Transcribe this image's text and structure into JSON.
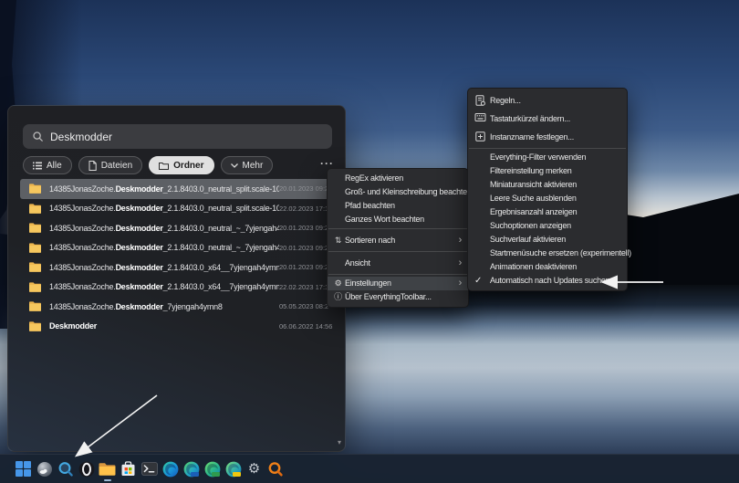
{
  "desktop": {
    "wallpaper_colors": {
      "sky_top": "#1c3258",
      "sky_mid": "#3f5d8a",
      "horizon": "#e6e3dc",
      "mountain": "#06090e",
      "water_light": "#b3c0cc",
      "water_dark": "#16202e",
      "taskbar": "#192332"
    }
  },
  "search_window": {
    "search": {
      "value": "Deskmodder",
      "icon": "search-icon"
    },
    "filters": [
      {
        "label": "Alle",
        "icon": "list-icon",
        "selected": false
      },
      {
        "label": "Dateien",
        "icon": "file-icon",
        "selected": false
      },
      {
        "label": "Ordner",
        "icon": "folder-icon",
        "selected": true
      },
      {
        "label": "Mehr",
        "icon": "chevron-down-icon",
        "selected": false
      }
    ],
    "more_label": "···",
    "results": [
      {
        "prefix": "14385JonasZoche.",
        "bold": "Deskmodder",
        "suffix": "_2.1.8403.0_neutral_split.scale-10...",
        "date": "20.01.2023 09:2",
        "selected": true
      },
      {
        "prefix": "14385JonasZoche.",
        "bold": "Deskmodder",
        "suffix": "_2.1.8403.0_neutral_split.scale-10...",
        "date": "22.02.2023 17:1",
        "selected": false
      },
      {
        "prefix": "14385JonasZoche.",
        "bold": "Deskmodder",
        "suffix": "_2.1.8403.0_neutral_~_7yjengah4...",
        "date": "20.01.2023 09:2",
        "selected": false
      },
      {
        "prefix": "14385JonasZoche.",
        "bold": "Deskmodder",
        "suffix": "_2.1.8403.0_neutral_~_7yjengah4...",
        "date": "20.01.2023 09:2",
        "selected": false
      },
      {
        "prefix": "14385JonasZoche.",
        "bold": "Deskmodder",
        "suffix": "_2.1.8403.0_x64__7yjengah4ymn8",
        "date": "20.01.2023 09:2",
        "selected": false
      },
      {
        "prefix": "14385JonasZoche.",
        "bold": "Deskmodder",
        "suffix": "_2.1.8403.0_x64__7yjengah4ymn8",
        "date": "22.02.2023 17:1",
        "selected": false
      },
      {
        "prefix": "14385JonasZoche.",
        "bold": "Deskmodder",
        "suffix": "_7yjengah4ymn8",
        "date": "05.05.2023 08:2",
        "selected": false
      },
      {
        "prefix": "",
        "bold": "Deskmodder",
        "suffix": "",
        "date": "06.06.2022 14:56",
        "selected": false
      }
    ]
  },
  "context_menu": {
    "items": [
      {
        "label": "RegEx aktivieren"
      },
      {
        "label": "Groß- und Kleinschreibung beachten"
      },
      {
        "label": "Pfad beachten"
      },
      {
        "label": "Ganzes Wort beachten"
      },
      {
        "label": "Sortieren nach",
        "icon": "sort-icon",
        "has_submenu": true
      },
      {
        "label": "Ansicht",
        "has_submenu": true
      },
      {
        "label": "Einstellungen",
        "icon": "gear-icon",
        "has_submenu": true,
        "highlighted": true
      },
      {
        "label": "Über EverythingToolbar...",
        "icon": "info-icon"
      }
    ],
    "sort_icon_glyph": "⇅",
    "gear_icon_glyph": "⚙",
    "info_icon_glyph": "ⓘ",
    "chevron_glyph": "›"
  },
  "settings_submenu": {
    "items": [
      {
        "label": "Regeln...",
        "icon": "rules-icon"
      },
      {
        "label": "Tastaturkürzel ändern...",
        "icon": "keyboard-icon"
      },
      {
        "label": "Instanzname festlegen...",
        "icon": "instance-name-icon"
      },
      {
        "label": "Everything-Filter verwenden",
        "checked": false
      },
      {
        "label": "Filtereinstellung merken",
        "checked": false
      },
      {
        "label": "Miniaturansicht aktivieren",
        "checked": false
      },
      {
        "label": "Leere Suche ausblenden",
        "checked": false
      },
      {
        "label": "Ergebnisanzahl anzeigen",
        "checked": false
      },
      {
        "label": "Suchoptionen anzeigen",
        "checked": false
      },
      {
        "label": "Suchverlauf aktivieren",
        "checked": false
      },
      {
        "label": "Startmenüsuche ersetzen (experimentell)",
        "checked": false
      },
      {
        "label": "Animationen deaktivieren",
        "checked": false
      },
      {
        "label": "Automatisch nach Updates suchen",
        "checked": true
      }
    ],
    "check_glyph": "✓"
  },
  "taskbar": {
    "icons": [
      "start-icon",
      "search-orb-icon",
      "everything-toolbar-icon",
      "opera-icon",
      "file-explorer-icon",
      "microsoft-store-icon",
      "terminal-icon",
      "edge-icon",
      "edge-beta-icon",
      "edge-dev-icon",
      "edge-canary-icon",
      "settings-gear-icon",
      "everything-app-icon"
    ],
    "running_indicator_on": "file-explorer-icon"
  },
  "annotations": {
    "arrow_targets": [
      "menu-item-automatisch-nach-updates-suchen",
      "taskbar-everything-toolbar-button"
    ]
  }
}
